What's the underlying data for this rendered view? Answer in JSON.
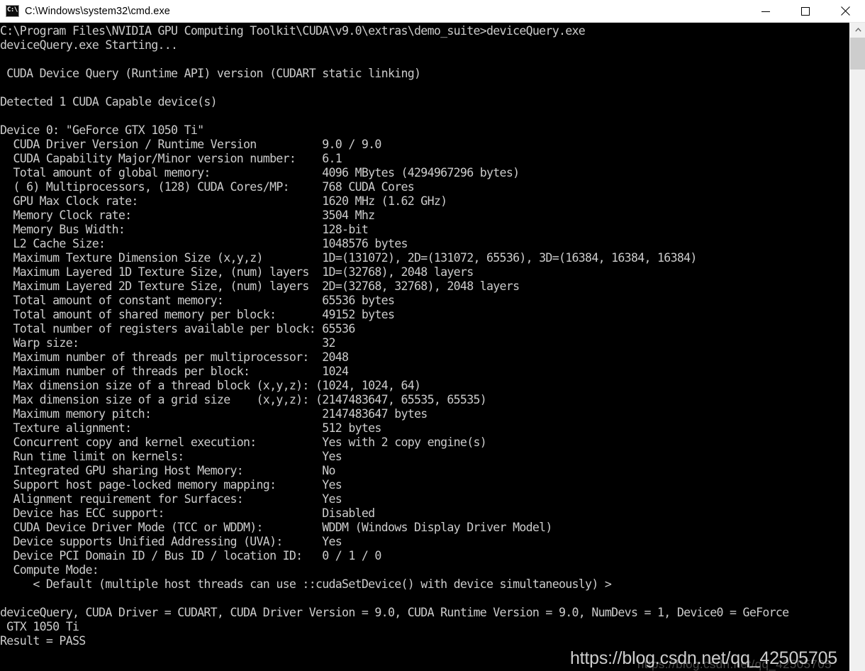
{
  "window": {
    "title": "C:\\Windows\\system32\\cmd.exe",
    "icon_glyph": "C:\\",
    "icon_name": "cmd-icon",
    "minimize_label": "Minimize",
    "maximize_label": "Maximize",
    "close_label": "Close",
    "background_color": "#000000",
    "text_color": "#cccccc",
    "titlebar_color": "#ffffff"
  },
  "scrollbar": {
    "up_arrow": "▲",
    "down_arrow": "▼",
    "thumb_color": "#cdcdcd",
    "track_color": "#f0f0f0"
  },
  "watermark": {
    "text": "https://blog.csdn.net/qq_42505705",
    "sub_text": "https://blog.csdn.net/qq_42505705"
  },
  "console": {
    "prompt_line": "C:\\Program Files\\NVIDIA GPU Computing Toolkit\\CUDA\\v9.0\\extras\\demo_suite>deviceQuery.exe",
    "lines": [
      "C:\\Program Files\\NVIDIA GPU Computing Toolkit\\CUDA\\v9.0\\extras\\demo_suite>deviceQuery.exe",
      "deviceQuery.exe Starting...",
      "",
      " CUDA Device Query (Runtime API) version (CUDART static linking)",
      "",
      "Detected 1 CUDA Capable device(s)",
      "",
      "Device 0: \"GeForce GTX 1050 Ti\"",
      "  CUDA Driver Version / Runtime Version          9.0 / 9.0",
      "  CUDA Capability Major/Minor version number:    6.1",
      "  Total amount of global memory:                 4096 MBytes (4294967296 bytes)",
      "  ( 6) Multiprocessors, (128) CUDA Cores/MP:     768 CUDA Cores",
      "  GPU Max Clock rate:                            1620 MHz (1.62 GHz)",
      "  Memory Clock rate:                             3504 Mhz",
      "  Memory Bus Width:                              128-bit",
      "  L2 Cache Size:                                 1048576 bytes",
      "  Maximum Texture Dimension Size (x,y,z)         1D=(131072), 2D=(131072, 65536), 3D=(16384, 16384, 16384)",
      "  Maximum Layered 1D Texture Size, (num) layers  1D=(32768), 2048 layers",
      "  Maximum Layered 2D Texture Size, (num) layers  2D=(32768, 32768), 2048 layers",
      "  Total amount of constant memory:               65536 bytes",
      "  Total amount of shared memory per block:       49152 bytes",
      "  Total number of registers available per block: 65536",
      "  Warp size:                                     32",
      "  Maximum number of threads per multiprocessor:  2048",
      "  Maximum number of threads per block:           1024",
      "  Max dimension size of a thread block (x,y,z): (1024, 1024, 64)",
      "  Max dimension size of a grid size    (x,y,z): (2147483647, 65535, 65535)",
      "  Maximum memory pitch:                          2147483647 bytes",
      "  Texture alignment:                             512 bytes",
      "  Concurrent copy and kernel execution:          Yes with 2 copy engine(s)",
      "  Run time limit on kernels:                     Yes",
      "  Integrated GPU sharing Host Memory:            No",
      "  Support host page-locked memory mapping:       Yes",
      "  Alignment requirement for Surfaces:            Yes",
      "  Device has ECC support:                        Disabled",
      "  CUDA Device Driver Mode (TCC or WDDM):         WDDM (Windows Display Driver Model)",
      "  Device supports Unified Addressing (UVA):      Yes",
      "  Device PCI Domain ID / Bus ID / location ID:   0 / 1 / 0",
      "  Compute Mode:",
      "     < Default (multiple host threads can use ::cudaSetDevice() with device simultaneously) >",
      "",
      "deviceQuery, CUDA Driver = CUDART, CUDA Driver Version = 9.0, CUDA Runtime Version = 9.0, NumDevs = 1, Device0 = GeForce",
      " GTX 1050 Ti",
      "Result = PASS"
    ],
    "device": {
      "index": "Device 0",
      "name": "GeForce GTX 1050 Ti",
      "cuda_driver_version": "9.0",
      "cuda_runtime_version": "9.0",
      "capability": "6.1",
      "global_memory": "4096 MBytes (4294967296 bytes)",
      "multiprocessors": "6",
      "cores_per_mp": "128",
      "cuda_cores": "768 CUDA Cores",
      "gpu_max_clock": "1620 MHz (1.62 GHz)",
      "memory_clock": "3504 Mhz",
      "memory_bus_width": "128-bit",
      "l2_cache_size": "1048576 bytes",
      "max_texture_dim": "1D=(131072), 2D=(131072, 65536), 3D=(16384, 16384, 16384)",
      "max_layered_1d": "1D=(32768), 2048 layers",
      "max_layered_2d": "2D=(32768, 32768), 2048 layers",
      "constant_memory": "65536 bytes",
      "shared_memory_per_block": "49152 bytes",
      "registers_per_block": "65536",
      "warp_size": "32",
      "max_threads_per_mp": "2048",
      "max_threads_per_block": "1024",
      "max_thread_block_dim": "(1024, 1024, 64)",
      "max_grid_dim": "(2147483647, 65535, 65535)",
      "max_memory_pitch": "2147483647 bytes",
      "texture_alignment": "512 bytes",
      "concurrent_copy": "Yes with 2 copy engine(s)",
      "run_time_limit": "Yes",
      "integrated_gpu": "No",
      "page_locked_mapping": "Yes",
      "surface_alignment": "Yes",
      "ecc_support": "Disabled",
      "driver_mode": "WDDM (Windows Display Driver Model)",
      "unified_addressing": "Yes",
      "pci_ids": "0 / 1 / 0",
      "compute_mode": "< Default (multiple host threads can use ::cudaSetDevice() with device simultaneously) >"
    },
    "summary": {
      "detected_devices": "Detected 1 CUDA Capable device(s)",
      "header": " CUDA Device Query (Runtime API) version (CUDART static linking)",
      "starting": "deviceQuery.exe Starting...",
      "result": "Result = PASS"
    }
  }
}
